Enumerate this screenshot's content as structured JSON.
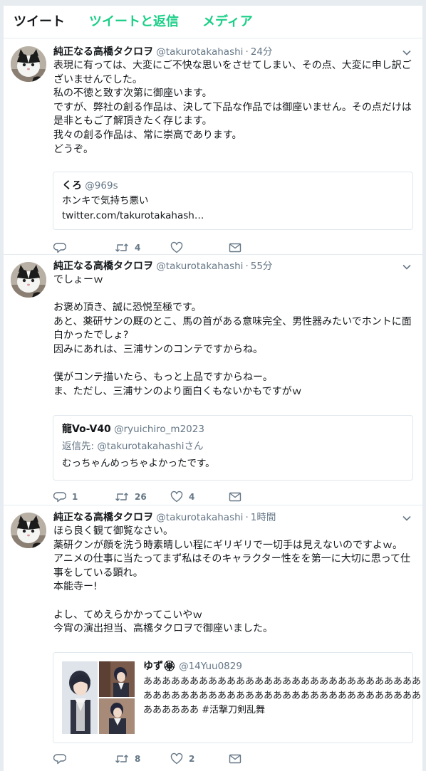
{
  "tabs": {
    "tweets": "ツイート",
    "tweets_replies": "ツイートと返信",
    "media": "メディア"
  },
  "tweets": [
    {
      "user_name": "純正なる高橋タクロヲ",
      "handle": "@takurotakahashi",
      "sep": "·",
      "time": "24分",
      "lines": [
        "表現に有っては、大変にご不快な思いをさせてしまい、その点、大変に申し訳ご",
        "ざいませんでした。",
        "私の不徳と致す次第に御座います。",
        "ですが、弊社の創る作品は、決して下品な作品では御座いません。その点だけは",
        "是非ともご了解頂きたく存じます。",
        "我々の創る作品は、常に崇高であります。",
        "どうぞ。"
      ],
      "quote": {
        "name": "くろ",
        "handle": "@969s",
        "text": "ホンキで気持ち悪い",
        "link": "twitter.com/takurotakahash…"
      },
      "reply_count": "",
      "retweet_count": "4",
      "like_count": ""
    },
    {
      "user_name": "純正なる高橋タクロヲ",
      "handle": "@takurotakahashi",
      "sep": "·",
      "time": "55分",
      "lines": [
        "でしょーｗ",
        "",
        "お褒め頂き、誠に恐悦至極です。",
        "あと、薬研サンの厩のとこ、馬の首がある意味完全、男性器みたいでホントに面",
        "白かったでしょ?",
        "因みにあれは、三浦サンのコンテですからね。",
        "",
        "僕がコンテ描いたら、もっと上品ですからねー。",
        "ま、ただし、三浦サンのより面白くもないかもですがｗ"
      ],
      "quote": {
        "name": "龍Vo-V40",
        "handle": "@ryuichiro_m2023",
        "reply_prefix": "返信先:",
        "reply_to": "@takurotakahashiさん",
        "text": "むっちゃんめっちゃよかったです。"
      },
      "reply_count": "1",
      "retweet_count": "26",
      "like_count": "4"
    },
    {
      "user_name": "純正なる高橋タクロヲ",
      "handle": "@takurotakahashi",
      "sep": "·",
      "time": "1時間",
      "lines": [
        "ほら良く観て御覧なさい。",
        "薬研クンが顔を洗う時素晴しい程にギリギリで一切手は見えないのですよｗ。",
        "アニメの仕事に当たってまず私はそのキャラクター性をを第一に大切に思って仕",
        "事をしている顕れ。",
        "本能寺ー!",
        "",
        "よし、てめえらかかってこいやｗ",
        "今宵の演出担当、高橋タクロヲで御座いました。"
      ],
      "quote": {
        "name": "ゆず🏵",
        "handle": "@14Yuu0829",
        "lines": [
          "ああああああああああああああああああああああああああああああ",
          "ああああああああああああああああああああああああああああああ",
          "ああああああ #活撃刀剣乱舞"
        ]
      },
      "reply_count": "",
      "retweet_count": "8",
      "like_count": "2"
    }
  ],
  "colors": {
    "accent_green": "#19cf86",
    "link_blue": "#1da1f2",
    "gray_text": "#657786",
    "border": "#e1e8ed",
    "background": "#e6ecf0"
  },
  "icons": [
    "chevron-down-icon",
    "reply-icon",
    "retweet-icon",
    "like-icon",
    "dm-icon"
  ]
}
